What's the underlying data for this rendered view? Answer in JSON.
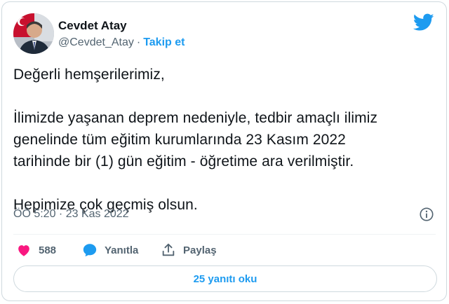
{
  "tweet": {
    "author_name": "Cevdet Atay",
    "author_handle": "@Cevdet_Atay",
    "separator": "·",
    "follow_label": "Takip et",
    "body_lines": {
      "greeting": "Değerli hemşerilerimiz,",
      "line1": "İlimizde yaşanan deprem nedeniyle, tedbir amaçlı ilimiz",
      "line2": "genelinde tüm eğitim kurumlarında 23 Kasım 2022",
      "line3": "tarihinde bir (1) gün eğitim - öğretime ara verilmiştir.",
      "closing": "Hepimize çok geçmiş olsun."
    },
    "timestamp": "ÖÖ 5:20 · 23 Kas 2022"
  },
  "actions": {
    "like_count": "588",
    "reply_label": "Yanıtla",
    "share_label": "Paylaş"
  },
  "read_replies_label": "25 yanıtı oku",
  "icons": {
    "brand": "twitter-bird-icon",
    "info": "info-icon",
    "like": "heart-icon",
    "reply": "speech-bubble-icon",
    "share": "share-icon"
  },
  "colors": {
    "accent": "#1d9bf0",
    "like": "#f91880",
    "muted": "#536471",
    "text": "#0f1419",
    "border": "#cfd9de"
  }
}
